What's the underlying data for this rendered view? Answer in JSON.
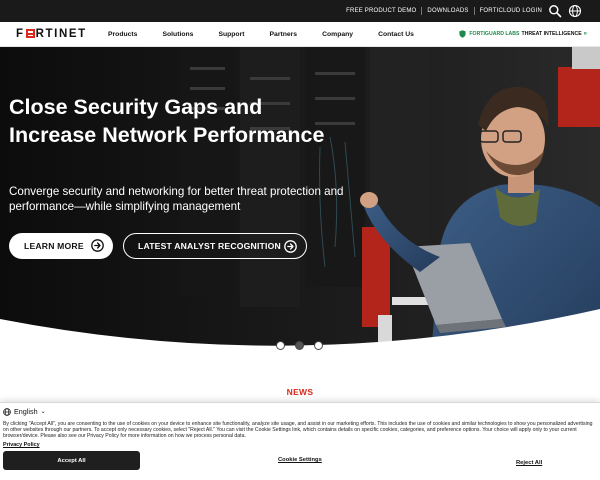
{
  "utility_bar": {
    "links": [
      "FREE PRODUCT DEMO",
      "DOWNLOADS",
      "FORTICLOUD LOGIN"
    ]
  },
  "nav": {
    "logo_text": "FORTINET",
    "logo_prefix": "F",
    "logo_suffix": "RTINET",
    "items": [
      "Products",
      "Solutions",
      "Support",
      "Partners",
      "Company",
      "Contact Us"
    ],
    "fortiguard": {
      "brand": "FORTIGUARD LABS",
      "label": "THREAT INTELLIGENCE",
      "chevron": "»"
    }
  },
  "hero": {
    "title": "Close Security Gaps and Increase Network Performance",
    "subtitle": "Converge security and networking for better threat protection and performance—while simplifying management",
    "primary_button": "LEARN MORE",
    "secondary_button": "LATEST ANALYST RECOGNITION",
    "carousel_slides": 3,
    "carousel_active_index": 1
  },
  "news": {
    "heading": "NEWS"
  },
  "cookie_banner": {
    "language": "English",
    "text": "By clicking \"Accept All\", you are consenting to the use of cookies on your device to enhance site functionality, analyze site usage, and assist in our marketing efforts. This includes the use of cookies and similar technologies to show you personalized advertising on other websites through our partners. To accept only necessary cookies, select \"Reject All.\" You can visit the Cookie Settings link, which contains details on specific cookies, categories, and preference options. Your choice will apply only to your current browser/device. Please also see our Privacy Policy for more information on how we process personal data.",
    "privacy_link": "Privacy Policy",
    "accept": "Accept All",
    "settings": "Cookie Settings",
    "reject": "Reject All"
  },
  "colors": {
    "brand_red": "#da291c",
    "fortiguard_green": "#1f8a4c",
    "utility_bar": "#1a1a1a",
    "accept_button": "#1f1f1f"
  },
  "icons": {
    "utility": [
      "search-icon",
      "globe-icon"
    ],
    "buttons": [
      "arrow-circle-right-icon"
    ],
    "fortiguard": "shield-icon",
    "language": "globe-icon"
  }
}
